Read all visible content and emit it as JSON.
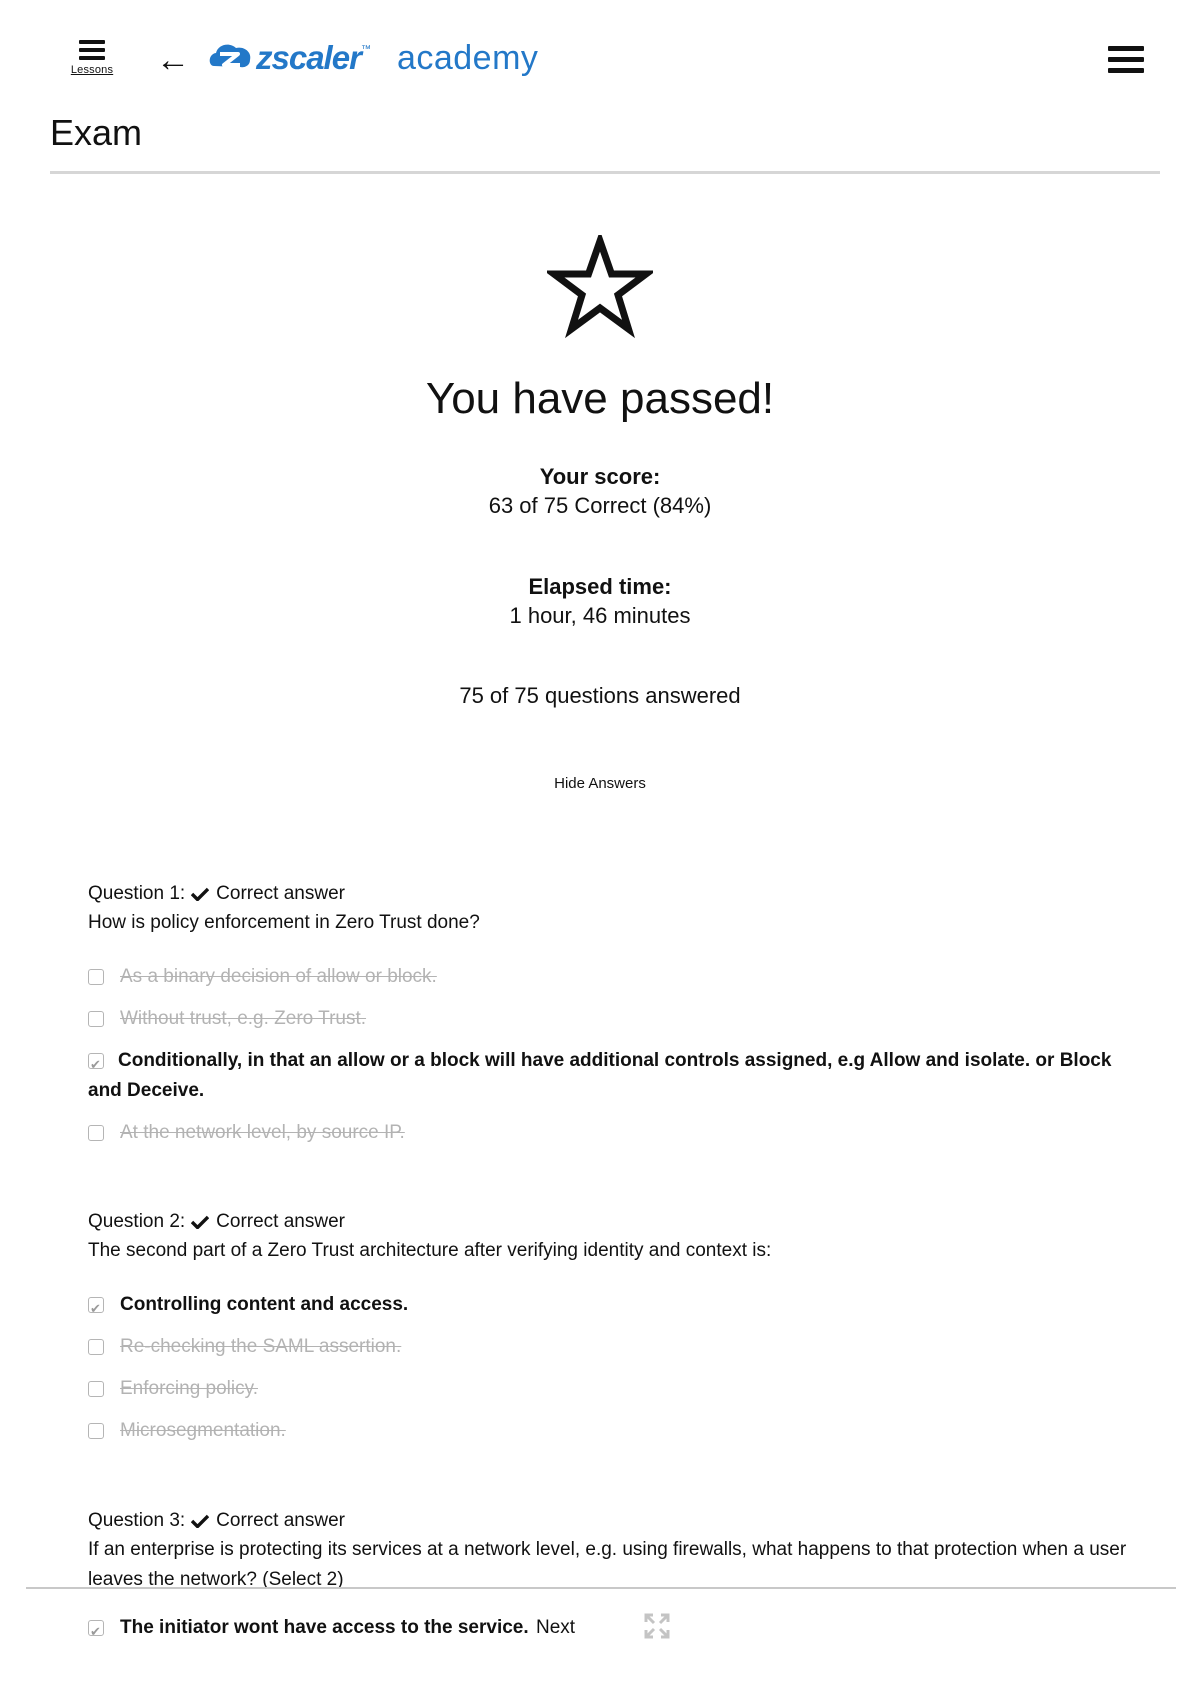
{
  "header": {
    "lessons_label": "Lessons",
    "back_arrow": "←",
    "brand": "zscaler",
    "brand_tm": "™",
    "academy": "academy",
    "brand_color": "#2378c8",
    "icons": [
      "hamburger-icon",
      "back-arrow-icon",
      "zscaler-logo",
      "menu-icon"
    ]
  },
  "page": {
    "title": "Exam"
  },
  "results": {
    "headline": "You have passed!",
    "score_label": "Your score:",
    "score_value": "63 of 75 Correct (84%)",
    "time_label": "Elapsed time:",
    "time_value": "1 hour, 46 minutes",
    "answered": "75 of 75 questions answered",
    "hide_answers": "Hide Answers",
    "icon": "star-outline-icon"
  },
  "questions": [
    {
      "label": "Question 1:",
      "status": "Correct answer",
      "text": "How is policy enforcement in Zero Trust done?",
      "options": [
        {
          "text": "As a binary decision of allow or block.",
          "checked": false,
          "correct": false
        },
        {
          "text": "Without trust, e.g. Zero Trust.",
          "checked": false,
          "correct": false
        },
        {
          "text": "Conditionally, in that an allow or a block will have additional controls assigned, e.g Allow and isolate. or Block and Deceive.",
          "checked": true,
          "correct": true
        },
        {
          "text": "At the network level, by source IP.",
          "checked": false,
          "correct": false
        }
      ]
    },
    {
      "label": "Question 2:",
      "status": "Correct answer",
      "text": "The second part of a Zero Trust architecture after verifying identity and context is:",
      "options": [
        {
          "text": "Controlling content and access.",
          "checked": true,
          "correct": true
        },
        {
          "text": "Re-checking the SAML assertion.",
          "checked": false,
          "correct": false
        },
        {
          "text": "Enforcing policy.",
          "checked": false,
          "correct": false
        },
        {
          "text": "Microsegmentation.",
          "checked": false,
          "correct": false
        }
      ]
    },
    {
      "label": "Question 3:",
      "status": "Correct answer",
      "text": "If an enterprise is protecting its services at a network level, e.g. using firewalls, what happens to that protection when a user leaves the network? (Select 2)",
      "options": [
        {
          "text": "The initiator wont have access to the service.",
          "checked": true,
          "correct": true
        }
      ]
    }
  ],
  "footer": {
    "next_label": "Next",
    "expand_icon": "expand-icon"
  }
}
